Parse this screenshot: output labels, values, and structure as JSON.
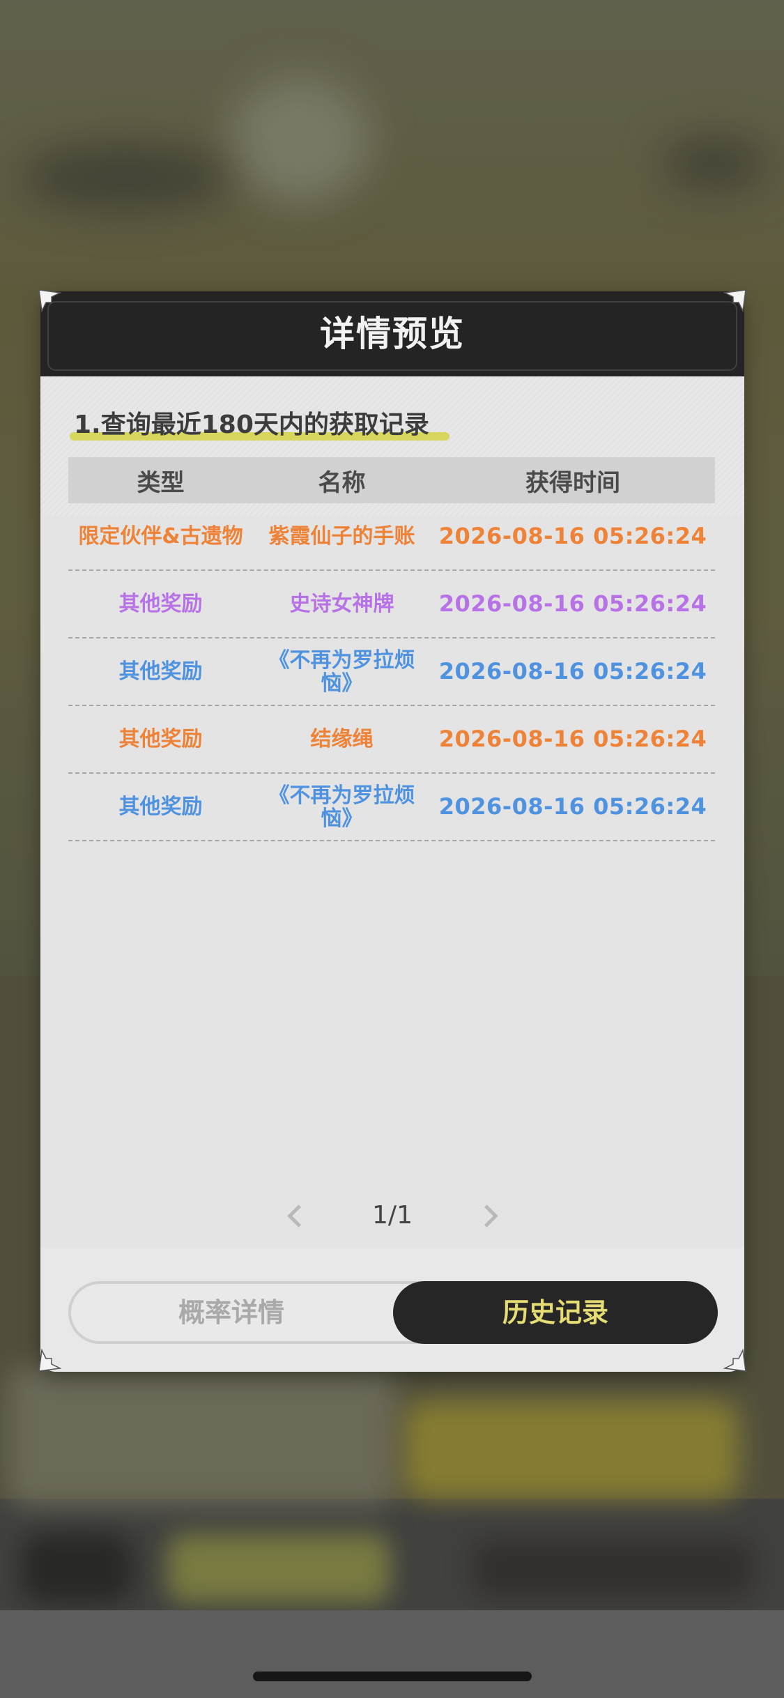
{
  "modal": {
    "title": "详情预览",
    "query_title": "1.查询最近180天内的获取记录"
  },
  "table": {
    "headers": [
      "类型",
      "名称",
      "获得时间"
    ],
    "rows": [
      {
        "type": "限定伙伴&古遗物",
        "name": "紫霞仙子的手账",
        "time": "2026-08-16 05:26:24",
        "color": "#ee8338"
      },
      {
        "type": "其他奖励",
        "name": "史诗女神牌",
        "time": "2026-08-16 05:26:24",
        "color": "#b772e6"
      },
      {
        "type": "其他奖励",
        "name": "《不再为罗拉烦恼》",
        "time": "2026-08-16 05:26:24",
        "color": "#4f93e0"
      },
      {
        "type": "其他奖励",
        "name": "结缘绳",
        "time": "2026-08-16 05:26:24",
        "color": "#ee8338"
      },
      {
        "type": "其他奖励",
        "name": "《不再为罗拉烦恼》",
        "time": "2026-08-16 05:26:24",
        "color": "#4f93e0"
      }
    ]
  },
  "pager": {
    "text": "1/1",
    "prev_icon": "chevron-left-icon",
    "next_icon": "chevron-right-icon"
  },
  "tabs": {
    "inactive_label": "概率详情",
    "active_label": "历史记录"
  },
  "colors": {
    "header_bg": "#242424",
    "active_tab_text": "#e5dd74",
    "highlight": "#d8d65c"
  }
}
